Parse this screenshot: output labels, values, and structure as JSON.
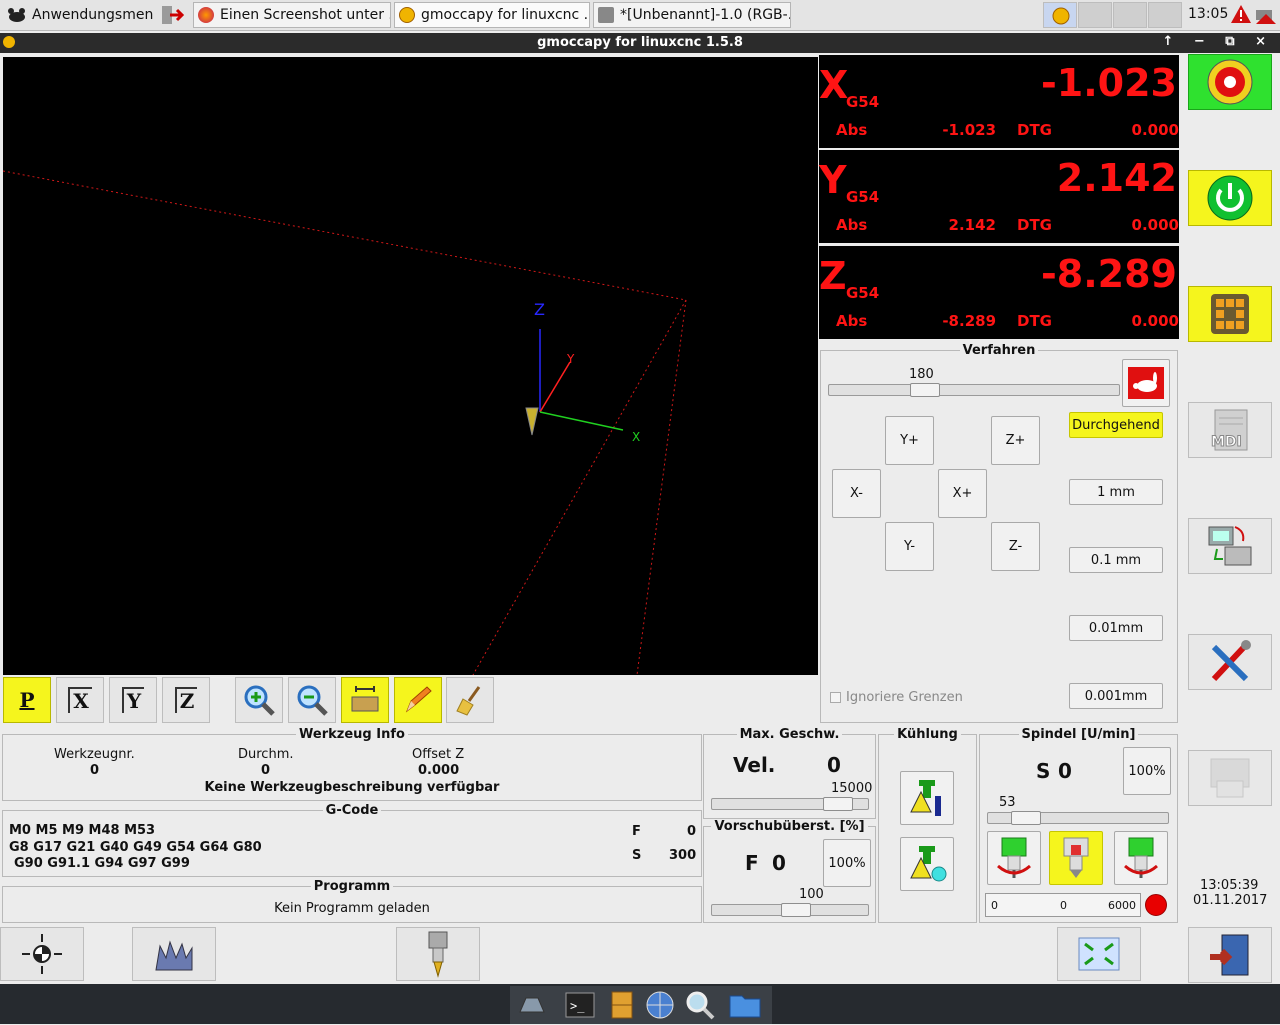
{
  "taskbar": {
    "app_menu": "Anwendungsmenü",
    "items": [
      "Einen Screenshot unter ...",
      "gmoccapy for linuxcnc  ...",
      "*[Unbenannt]-1.0 (RGB-..."
    ],
    "clock": "13:05"
  },
  "window": {
    "title": "gmoccapy for linuxcnc  1.5.8",
    "controls": "↑ − ⧉ ×"
  },
  "view_toolbar": {
    "p": "P",
    "x": "X",
    "y": "Y",
    "z": "Z"
  },
  "preview_labels": {
    "z_axis": "Z",
    "y_axis": "Y",
    "x_axis": "X"
  },
  "dro": [
    {
      "axis": "X",
      "coord": "G54",
      "value": "-1.023",
      "abs_label": "Abs",
      "abs": "-1.023",
      "dtg_label": "DTG",
      "dtg": "0.000"
    },
    {
      "axis": "Y",
      "coord": "G54",
      "value": "2.142",
      "abs_label": "Abs",
      "abs": "2.142",
      "dtg_label": "DTG",
      "dtg": "0.000"
    },
    {
      "axis": "Z",
      "coord": "G54",
      "value": "-8.289",
      "abs_label": "Abs",
      "abs": "-8.289",
      "dtg_label": "DTG",
      "dtg": "0.000"
    }
  ],
  "jog": {
    "title": "Verfahren",
    "speed": "180",
    "speed_fraction": 0.31,
    "buttons": {
      "yplus": "Y+",
      "zplus": "Z+",
      "xminus": "X-",
      "xplus": "X+",
      "yminus": "Y-",
      "zminus": "Z-"
    },
    "increments": [
      "Durchgehend",
      "1 mm",
      "0.1 mm",
      "0.01mm",
      "0.001mm"
    ],
    "ignore_limits": "Ignoriere Grenzen"
  },
  "tool_info": {
    "title": "Werkzeug Info",
    "col_tool": "Werkzeugnr.",
    "tool": "0",
    "col_diam": "Durchm.",
    "diam": "0",
    "col_offset": "Offset Z",
    "offset": "0.000",
    "desc": "Keine Werkzeugbeschreibung verfügbar"
  },
  "gcode": {
    "title": "G-Code",
    "line1": "M0 M5 M9 M48 M53",
    "line2": "G8 G17 G21 G40 G49 G54 G64 G80",
    "line3": "G90 G91.1 G94 G97 G99",
    "f_label": "F",
    "f": "0",
    "s_label": "S",
    "s": "300"
  },
  "program": {
    "title": "Programm",
    "status": "Kein Programm geladen"
  },
  "max_vel": {
    "title": "Max. Geschw.",
    "label": "Vel.",
    "value": "0",
    "max": "15000",
    "fraction": 0.88
  },
  "feed_override": {
    "title": "Vorschubüberst. [%]",
    "label": "F",
    "value": "0",
    "button": "100%",
    "slider": "100",
    "fraction": 0.55
  },
  "cooling": {
    "title": "Kühlung"
  },
  "spindle": {
    "title": "Spindel [U/min]",
    "label": "S",
    "value": "0",
    "button": "100%",
    "slider": "53",
    "fraction": 0.15,
    "bar_min": "0",
    "bar_val": "0",
    "bar_max": "6000"
  },
  "status": {
    "time": "13:05:39",
    "date": "01.11.2017"
  },
  "colors": {
    "dro_text": "#ff1414",
    "highlight": "#f5f51d",
    "estop_bg": "#2fe12f"
  }
}
